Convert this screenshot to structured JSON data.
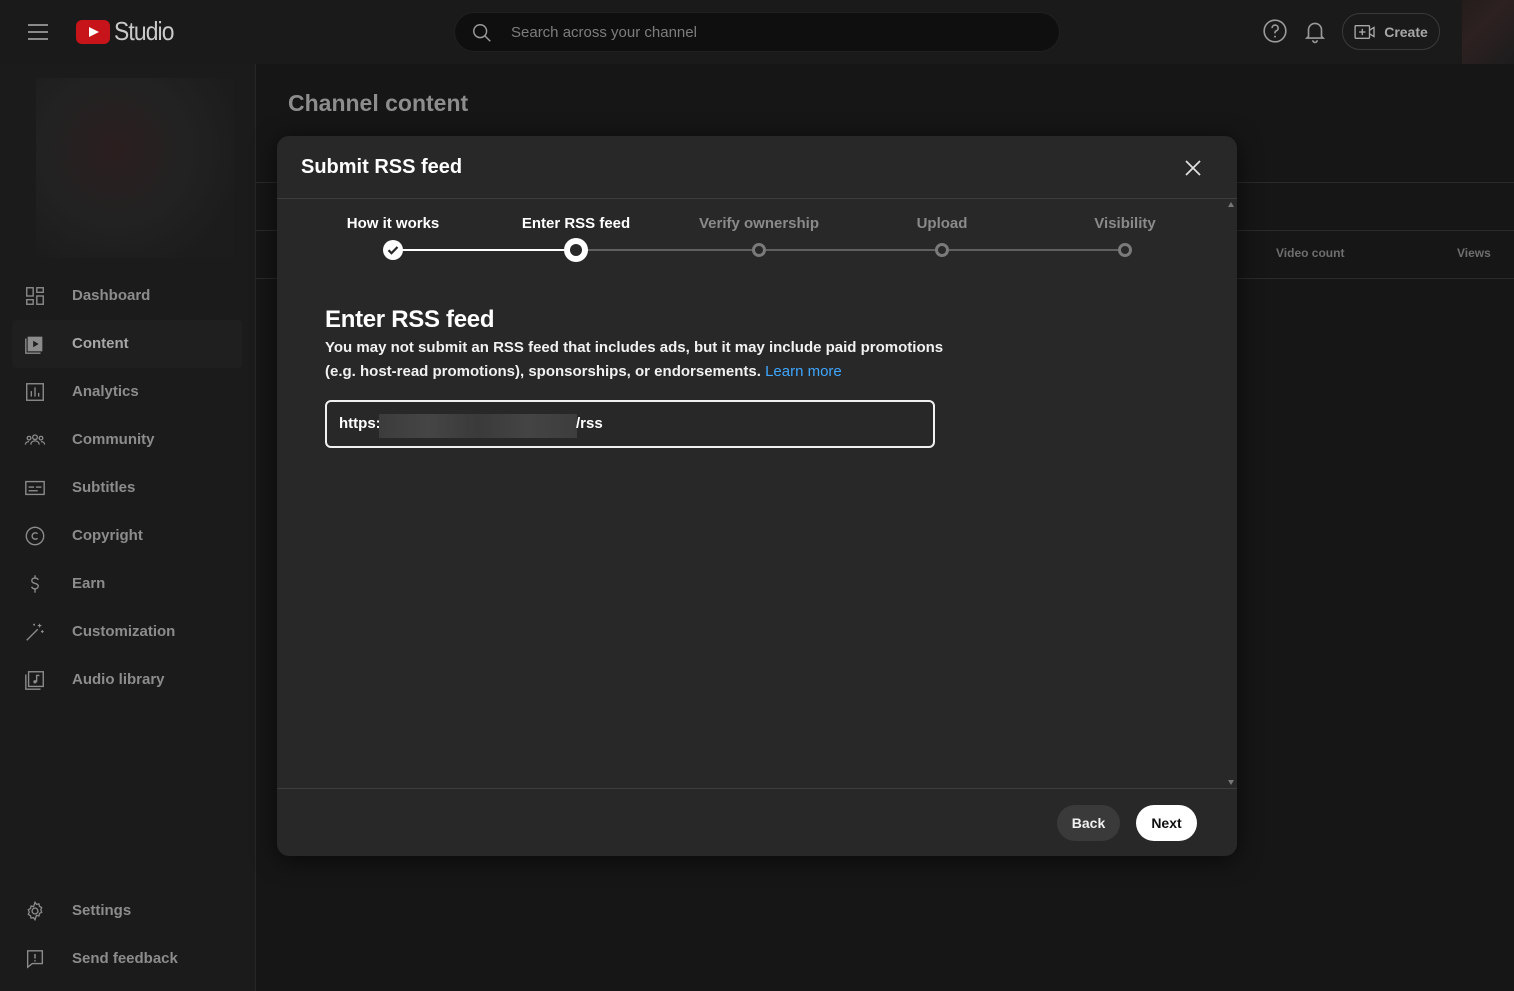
{
  "app": {
    "logo_text": "Studio"
  },
  "topbar": {
    "search_placeholder": "Search across your channel",
    "create_label": "Create"
  },
  "sidebar": {
    "items": [
      {
        "label": "Dashboard",
        "icon": "dashboard-icon"
      },
      {
        "label": "Content",
        "icon": "content-icon",
        "active": true
      },
      {
        "label": "Analytics",
        "icon": "analytics-icon"
      },
      {
        "label": "Community",
        "icon": "community-icon"
      },
      {
        "label": "Subtitles",
        "icon": "subtitles-icon"
      },
      {
        "label": "Copyright",
        "icon": "copyright-icon"
      },
      {
        "label": "Earn",
        "icon": "earn-icon"
      },
      {
        "label": "Customization",
        "icon": "customization-icon"
      },
      {
        "label": "Audio library",
        "icon": "audio-library-icon"
      }
    ],
    "bottom": [
      {
        "label": "Settings",
        "icon": "gear-icon"
      },
      {
        "label": "Send feedback",
        "icon": "feedback-icon"
      }
    ]
  },
  "main": {
    "title": "Channel content",
    "columns": [
      "Video count",
      "Views"
    ]
  },
  "modal": {
    "title": "Submit RSS feed",
    "steps": [
      {
        "label": "How it works",
        "state": "done"
      },
      {
        "label": "Enter RSS feed",
        "state": "current"
      },
      {
        "label": "Verify ownership",
        "state": "todo"
      },
      {
        "label": "Upload",
        "state": "todo"
      },
      {
        "label": "Visibility",
        "state": "todo"
      }
    ],
    "section_title": "Enter RSS feed",
    "description": "You may not submit an RSS feed that includes ads, but it may include paid promotions (e.g. host-read promotions), sponsorships, or endorsements.",
    "learn_more": "Learn more",
    "rss_prefix": "https:",
    "rss_suffix": "/rss",
    "back_label": "Back",
    "next_label": "Next"
  },
  "colors": {
    "accent_link": "#3ea6ff",
    "logo_red": "#c7141a",
    "modal_bg": "#282828"
  }
}
